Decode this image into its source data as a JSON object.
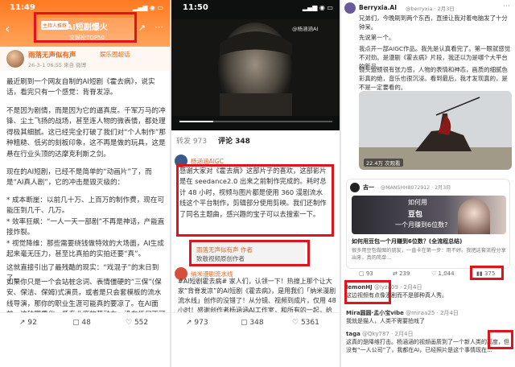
{
  "panel1": {
    "time": "11:49",
    "title": "AI短剧爆火",
    "subtitle": "文娱榜TOP50",
    "badge": "主持人推荐",
    "author": "雨落无声似有声",
    "tag": "娱乐圈超话",
    "meta": "26-3-1 06:55 来自 微博",
    "paragraphs": [
      "最近刷到一个网友自制的AI短剧《霍去病》，说实话，看完只有一个感觉：背脊发凉。",
      "不是因为剧情，而是因为它的逼真度。千军万马的冲锋、尘土飞扬的战场，甚至连人物的微表情，都处理得极其细腻。这已经完全打破了我们对“个人制作”那种粗糙、低劣的刻板印象，这不再是做的玩具，这是悬在行业头顶的达摩克利斯之剑。",
      "现在的AI短剧，已经不是简单的“动画片”了，而是“AI真人剧”，它的冲击是毁灭级的：",
      "* 成本断崖：以前几十万、上百万的制作费，现在可能压到几千、几万。",
      "* 效率狂飙：“一人一天一部剧”不再是神话，产能直接炸裂。",
      "* 视觉降维：那些需要绕钱做特效的大场面，AI生成起来毫无压力，甚至比真拍的实拍还要“真”。",
      "这就直接引出了最残酷的现实：“戏混子”的末日到了。",
      "如果你只是一个会站桩念词、表情僵硬的“三保”(保安、保洁、保姆)式演员，或者是只会套模板的流水线导演，那你的职业生涯可能真的要凉了。在AI面前，这种同质化、低专业度的劳动力，没有任何不可替代性。资本"
    ],
    "footer": {
      "share": "92",
      "comment": "48",
      "like": "552"
    }
  },
  "panel2": {
    "time": "11:50",
    "watermark": "@杨涵涵AI",
    "tab_reposts": "转发 973",
    "tab_comments": "评论 348",
    "commenter": "杨涵涵AIGC",
    "comment_text": "感谢大家对《霍去病》这部片子的喜欢，这部影片是在 seedance2.0 出来之前制作完成的。耗时总计 48 小时，视频与图片都是使用 360 漫剧流水线这个平台制作，剪辑部分使用剪映。我们还制作了同名主题曲，感兴趣的宝子可以去搜索一下。",
    "reply_line1": "雨落无声似有声 作者",
    "reply_line2": "致敬视频原创作者",
    "second_commenter": "纳米漫剧流水线",
    "second_comment": "#AI短剧霍去病# 家人们，认领一下！热搜上那个让大家“背脊发凉”的AI短剧《霍去病》，是用我们「纳米漫剧流水线」创作的没错了！从分镜、视频到成片，仅用 48 小时！感谢创作者杨涵涵AI工作室，和所有的一起，给大家带来刷屏海内外社交",
    "footer": {
      "share": "973",
      "comment": "348",
      "like": "5361"
    }
  },
  "panel3": {
    "author": "Berryxia.AI",
    "handle": "@berryxia · 2月3日",
    "body1": "兄弟们，今晚刷到两个东西，直接让我对着电脑发了十分钟呆。",
    "body2": "先说第一个。",
    "body3": "我点开一部AIGC作品。我先是认真看完了。第一眼就感觉不对劲。是漫剧《霍去病》片段，我还以为是哪个大平台的新品。",
    "body4": "镜头运镜很有张力感，人物的表情和神态，画质的细腻色彩真的绝，音乐也很沉浸。看到最后，我才发现真的，是不是一定要看的。",
    "video_views": "22.4万 次观看",
    "quote_author": "吉一",
    "quote_handle": "@MANSHH8072912 · 2月3日",
    "quote_title_lines": [
      "如何用",
      "豆包",
      "一个月赚到6位数?"
    ],
    "quote_caption": "如何用豆包一个月赚到6位数？(全流程总结)",
    "quote_summary": "很多用豆包做图的朋友，一直卡在第一步：用不好。我把这套流程分享出来，真的简单…",
    "stats": {
      "replies": "93",
      "reposts": "239",
      "likes": "1,044",
      "views": "375"
    },
    "replies": [
      {
        "name": "lemonHJ",
        "handle": "@lyza09 · 2月4日",
        "text": "这边视频有点像漫剧而不是那种真人秀。"
      },
      {
        "name": "Mira圆圆·孟小宝vibe",
        "handle": "@miraa25 · 2月4日",
        "text": "我就是猫人，人类不需要拍戏了"
      },
      {
        "name": "taga",
        "handle": "@Qky787 · 2月4日",
        "text": "这真的是降维打击。杨涵涵的视频画质到了一个新人类的高度，但没有“一人公司”了，我都在AI，已经照片是这个事情现在..."
      }
    ]
  }
}
